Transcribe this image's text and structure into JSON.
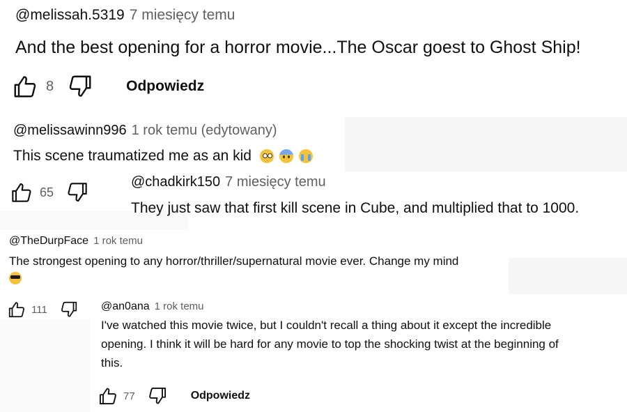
{
  "comment1": {
    "author": "@melissah.5319",
    "time": "7 miesięcy temu",
    "text": "And the best opening for a horror movie...The Oscar goest to Ghost Ship!",
    "likes": "8",
    "reply": "Odpowiedz"
  },
  "comment2": {
    "author": "@melissawinn996",
    "time": "1 rok temu (edytowany)",
    "text": "This scene traumatized me as an kid",
    "emojis": [
      "flushed-face",
      "fearful-face",
      "crying-face"
    ],
    "likes": "65"
  },
  "comment3": {
    "author": "@chadkirk150",
    "time": "7 miesięcy temu",
    "text": "They just saw that first kill scene in Cube, and multiplied that to 1000."
  },
  "comment4": {
    "author": "@TheDurpFace",
    "time": "1 rok temu",
    "text": "The strongest opening to any horror/thriller/supernatural movie ever. Change my mind",
    "emoji": "sunglasses-face",
    "likes": "111"
  },
  "comment5": {
    "author": "@an0ana",
    "time": "1 rok temu",
    "text_lines": [
      "I've watched this movie twice, but I couldn't recall a thing about it except the incredible",
      "opening. I think it will be hard for any movie to top the shocking twist at the beginning of",
      "this."
    ],
    "likes": "77",
    "reply": "Odpowiedz"
  },
  "colors": {
    "text": "#0f0f0f",
    "muted": "#606060",
    "emoji_yellow": "#f5c23b"
  }
}
